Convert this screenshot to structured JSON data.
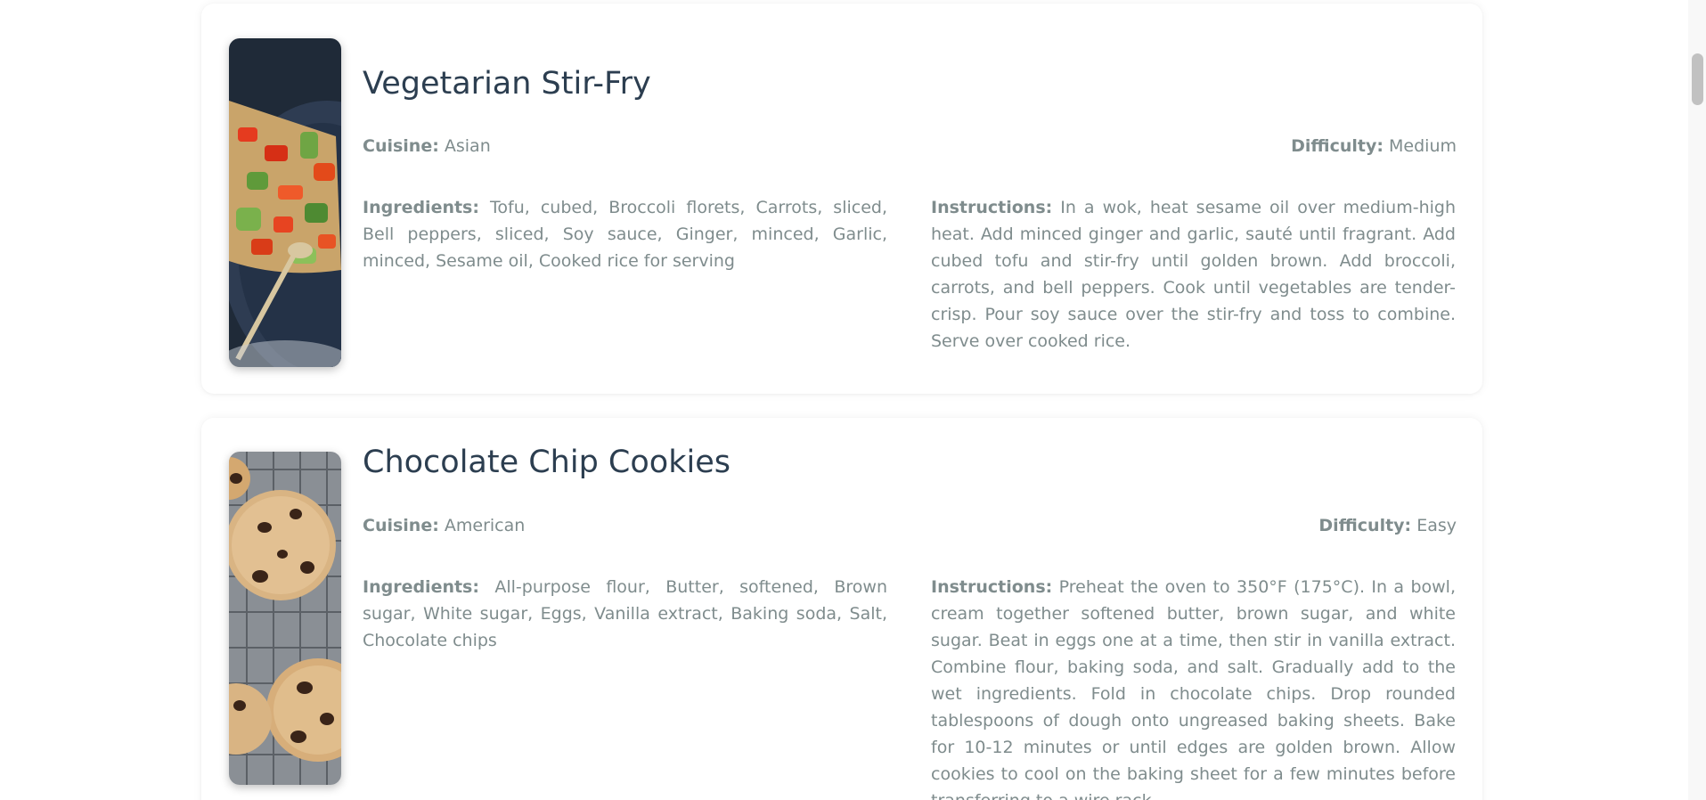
{
  "recipes": [
    {
      "title": "Vegetarian Stir-Fry",
      "cuisine_label": "Cuisine:",
      "cuisine": "Asian",
      "difficulty_label": "Difficulty:",
      "difficulty": "Medium",
      "ingredients_label": "Ingredients:",
      "ingredients": "Tofu, cubed, Broccoli florets, Carrots, sliced, Bell peppers, sliced, Soy sauce, Ginger, minced, Garlic, minced, Sesame oil, Cooked rice for serving",
      "instructions_label": "Instructions:",
      "instructions": "In a wok, heat sesame oil over medium-high heat. Add minced ginger and garlic, sauté until fragrant. Add cubed tofu and stir-fry until golden brown. Add broccoli, carrots, and bell peppers. Cook until vegetables are tender-crisp. Pour soy sauce over the stir-fry and toss to combine. Serve over cooked rice.",
      "image": "stir-fry-photo"
    },
    {
      "title": "Chocolate Chip Cookies",
      "cuisine_label": "Cuisine:",
      "cuisine": "American",
      "difficulty_label": "Difficulty:",
      "difficulty": "Easy",
      "ingredients_label": "Ingredients:",
      "ingredients": "All-purpose flour, Butter, softened, Brown sugar, White sugar, Eggs, Vanilla extract, Baking soda, Salt, Chocolate chips",
      "instructions_label": "Instructions:",
      "instructions": "Preheat the oven to 350°F (175°C). In a bowl, cream together softened butter, brown sugar, and white sugar. Beat in eggs one at a time, then stir in vanilla extract. Combine flour, baking soda, and salt. Gradually add to the wet ingredients. Fold in chocolate chips. Drop rounded tablespoons of dough onto ungreased baking sheets. Bake for 10-12 minutes or until edges are golden brown. Allow cookies to cool on the baking sheet for a few minutes before transferring to a wire rack.",
      "image": "cookies-photo"
    }
  ],
  "colors": {
    "title": "#2c3e50",
    "text": "#7f8c8d",
    "card_bg": "#ffffff"
  }
}
